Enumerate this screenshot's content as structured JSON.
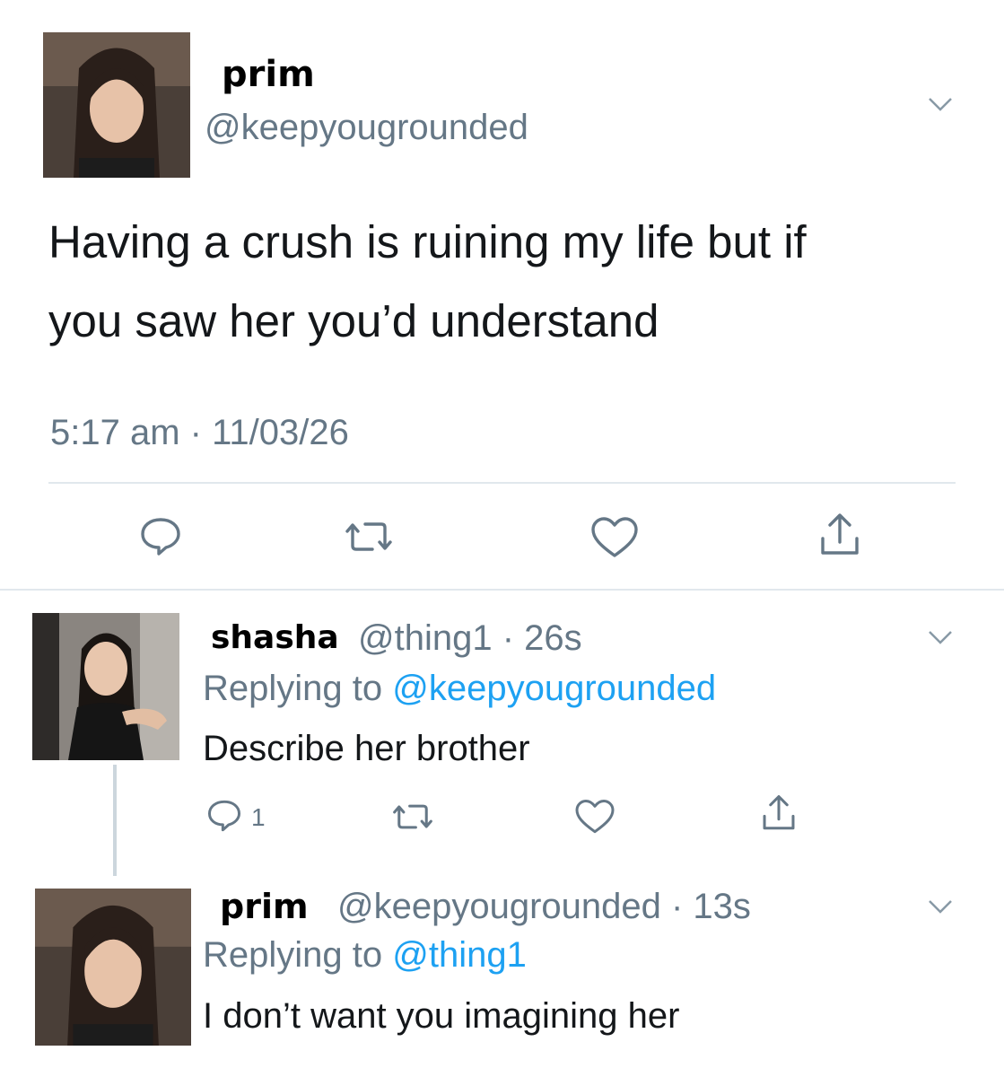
{
  "main_tweet": {
    "display_name": "prim",
    "handle": "@keepyougrounded",
    "text_line1": "Having a crush is ruining my life but if",
    "text_line2": "you saw her you’d understand",
    "timestamp": "5:17 am · 11/03/26",
    "actions": [
      "reply-icon",
      "retweet-icon",
      "like-icon",
      "share-icon"
    ]
  },
  "reply1": {
    "display_name": "shasha",
    "handle_time": "@thing1 · 26s",
    "replying_prefix": "Replying to ",
    "replying_to": "@keepyougrounded",
    "text": "Describe her brother",
    "reply_count": "1"
  },
  "reply2": {
    "display_name": "prim",
    "handle_time": "@keepyougrounded · 13s",
    "replying_prefix": "Replying to ",
    "replying_to": "@thing1",
    "text": "I don’t want you imagining her"
  },
  "colors": {
    "link": "#1da1f2",
    "muted": "#657786",
    "divider": "#e1e8ed"
  }
}
